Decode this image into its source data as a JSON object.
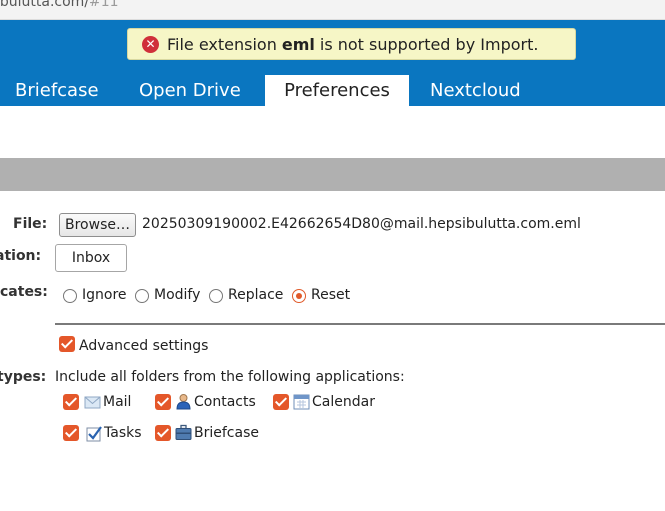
{
  "browser": {
    "url": "ibulutta.com/",
    "url_fragment": "#11"
  },
  "notification": {
    "prefix": "File extension",
    "extension": "eml",
    "suffix": "is not supported by Import.",
    "icon": "error-icon",
    "background": "#f6f6c6"
  },
  "tabs": [
    {
      "label": "Briefcase"
    },
    {
      "label": "Open Drive"
    },
    {
      "label": "Preferences",
      "active": true
    },
    {
      "label": "Nextcloud"
    }
  ],
  "colors": {
    "app_bar": "#0a76c0",
    "accent": "#e4572a",
    "section_bar": "#b0b0b0"
  },
  "form": {
    "file_label": "File:",
    "browse_label": "Browse…",
    "file_name": "20250309190002.E42662654D80@mail.hepsibulutta.com.eml",
    "destination_label": "ation:",
    "destination_value": "Inbox",
    "duplicates_label": "cates:",
    "duplicate_options": [
      {
        "label": "Ignore",
        "checked": false
      },
      {
        "label": "Modify",
        "checked": false
      },
      {
        "label": "Replace",
        "checked": false
      },
      {
        "label": "Reset",
        "checked": true
      }
    ],
    "advanced_label": "Advanced settings",
    "advanced_checked": true,
    "types_label": "types:",
    "types_intro": "Include all folders from the following applications:",
    "applications": [
      {
        "label": "Mail",
        "icon": "mail-icon",
        "checked": true
      },
      {
        "label": "Contacts",
        "icon": "contacts-icon",
        "checked": true
      },
      {
        "label": "Calendar",
        "icon": "calendar-icon",
        "checked": true
      },
      {
        "label": "Tasks",
        "icon": "tasks-icon",
        "checked": true
      },
      {
        "label": "Briefcase",
        "icon": "briefcase-icon",
        "checked": true
      }
    ]
  }
}
